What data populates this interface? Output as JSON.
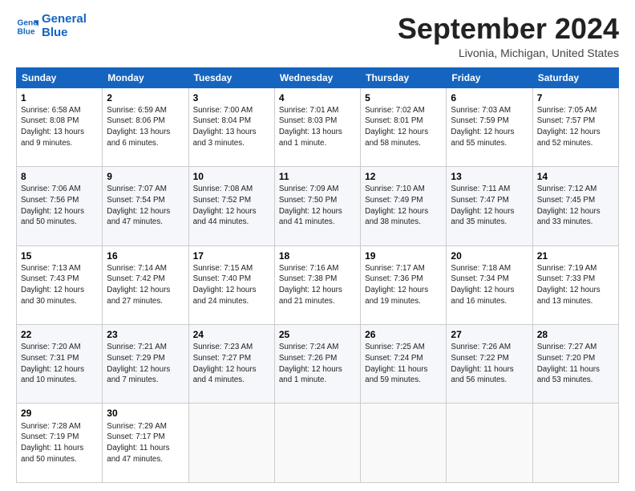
{
  "logo": {
    "line1": "General",
    "line2": "Blue"
  },
  "title": "September 2024",
  "location": "Livonia, Michigan, United States",
  "days_header": [
    "Sunday",
    "Monday",
    "Tuesday",
    "Wednesday",
    "Thursday",
    "Friday",
    "Saturday"
  ],
  "weeks": [
    [
      {
        "day": "1",
        "info": "Sunrise: 6:58 AM\nSunset: 8:08 PM\nDaylight: 13 hours\nand 9 minutes."
      },
      {
        "day": "2",
        "info": "Sunrise: 6:59 AM\nSunset: 8:06 PM\nDaylight: 13 hours\nand 6 minutes."
      },
      {
        "day": "3",
        "info": "Sunrise: 7:00 AM\nSunset: 8:04 PM\nDaylight: 13 hours\nand 3 minutes."
      },
      {
        "day": "4",
        "info": "Sunrise: 7:01 AM\nSunset: 8:03 PM\nDaylight: 13 hours\nand 1 minute."
      },
      {
        "day": "5",
        "info": "Sunrise: 7:02 AM\nSunset: 8:01 PM\nDaylight: 12 hours\nand 58 minutes."
      },
      {
        "day": "6",
        "info": "Sunrise: 7:03 AM\nSunset: 7:59 PM\nDaylight: 12 hours\nand 55 minutes."
      },
      {
        "day": "7",
        "info": "Sunrise: 7:05 AM\nSunset: 7:57 PM\nDaylight: 12 hours\nand 52 minutes."
      }
    ],
    [
      {
        "day": "8",
        "info": "Sunrise: 7:06 AM\nSunset: 7:56 PM\nDaylight: 12 hours\nand 50 minutes."
      },
      {
        "day": "9",
        "info": "Sunrise: 7:07 AM\nSunset: 7:54 PM\nDaylight: 12 hours\nand 47 minutes."
      },
      {
        "day": "10",
        "info": "Sunrise: 7:08 AM\nSunset: 7:52 PM\nDaylight: 12 hours\nand 44 minutes."
      },
      {
        "day": "11",
        "info": "Sunrise: 7:09 AM\nSunset: 7:50 PM\nDaylight: 12 hours\nand 41 minutes."
      },
      {
        "day": "12",
        "info": "Sunrise: 7:10 AM\nSunset: 7:49 PM\nDaylight: 12 hours\nand 38 minutes."
      },
      {
        "day": "13",
        "info": "Sunrise: 7:11 AM\nSunset: 7:47 PM\nDaylight: 12 hours\nand 35 minutes."
      },
      {
        "day": "14",
        "info": "Sunrise: 7:12 AM\nSunset: 7:45 PM\nDaylight: 12 hours\nand 33 minutes."
      }
    ],
    [
      {
        "day": "15",
        "info": "Sunrise: 7:13 AM\nSunset: 7:43 PM\nDaylight: 12 hours\nand 30 minutes."
      },
      {
        "day": "16",
        "info": "Sunrise: 7:14 AM\nSunset: 7:42 PM\nDaylight: 12 hours\nand 27 minutes."
      },
      {
        "day": "17",
        "info": "Sunrise: 7:15 AM\nSunset: 7:40 PM\nDaylight: 12 hours\nand 24 minutes."
      },
      {
        "day": "18",
        "info": "Sunrise: 7:16 AM\nSunset: 7:38 PM\nDaylight: 12 hours\nand 21 minutes."
      },
      {
        "day": "19",
        "info": "Sunrise: 7:17 AM\nSunset: 7:36 PM\nDaylight: 12 hours\nand 19 minutes."
      },
      {
        "day": "20",
        "info": "Sunrise: 7:18 AM\nSunset: 7:34 PM\nDaylight: 12 hours\nand 16 minutes."
      },
      {
        "day": "21",
        "info": "Sunrise: 7:19 AM\nSunset: 7:33 PM\nDaylight: 12 hours\nand 13 minutes."
      }
    ],
    [
      {
        "day": "22",
        "info": "Sunrise: 7:20 AM\nSunset: 7:31 PM\nDaylight: 12 hours\nand 10 minutes."
      },
      {
        "day": "23",
        "info": "Sunrise: 7:21 AM\nSunset: 7:29 PM\nDaylight: 12 hours\nand 7 minutes."
      },
      {
        "day": "24",
        "info": "Sunrise: 7:23 AM\nSunset: 7:27 PM\nDaylight: 12 hours\nand 4 minutes."
      },
      {
        "day": "25",
        "info": "Sunrise: 7:24 AM\nSunset: 7:26 PM\nDaylight: 12 hours\nand 1 minute."
      },
      {
        "day": "26",
        "info": "Sunrise: 7:25 AM\nSunset: 7:24 PM\nDaylight: 11 hours\nand 59 minutes."
      },
      {
        "day": "27",
        "info": "Sunrise: 7:26 AM\nSunset: 7:22 PM\nDaylight: 11 hours\nand 56 minutes."
      },
      {
        "day": "28",
        "info": "Sunrise: 7:27 AM\nSunset: 7:20 PM\nDaylight: 11 hours\nand 53 minutes."
      }
    ],
    [
      {
        "day": "29",
        "info": "Sunrise: 7:28 AM\nSunset: 7:19 PM\nDaylight: 11 hours\nand 50 minutes."
      },
      {
        "day": "30",
        "info": "Sunrise: 7:29 AM\nSunset: 7:17 PM\nDaylight: 11 hours\nand 47 minutes."
      },
      {
        "day": "",
        "info": ""
      },
      {
        "day": "",
        "info": ""
      },
      {
        "day": "",
        "info": ""
      },
      {
        "day": "",
        "info": ""
      },
      {
        "day": "",
        "info": ""
      }
    ]
  ]
}
